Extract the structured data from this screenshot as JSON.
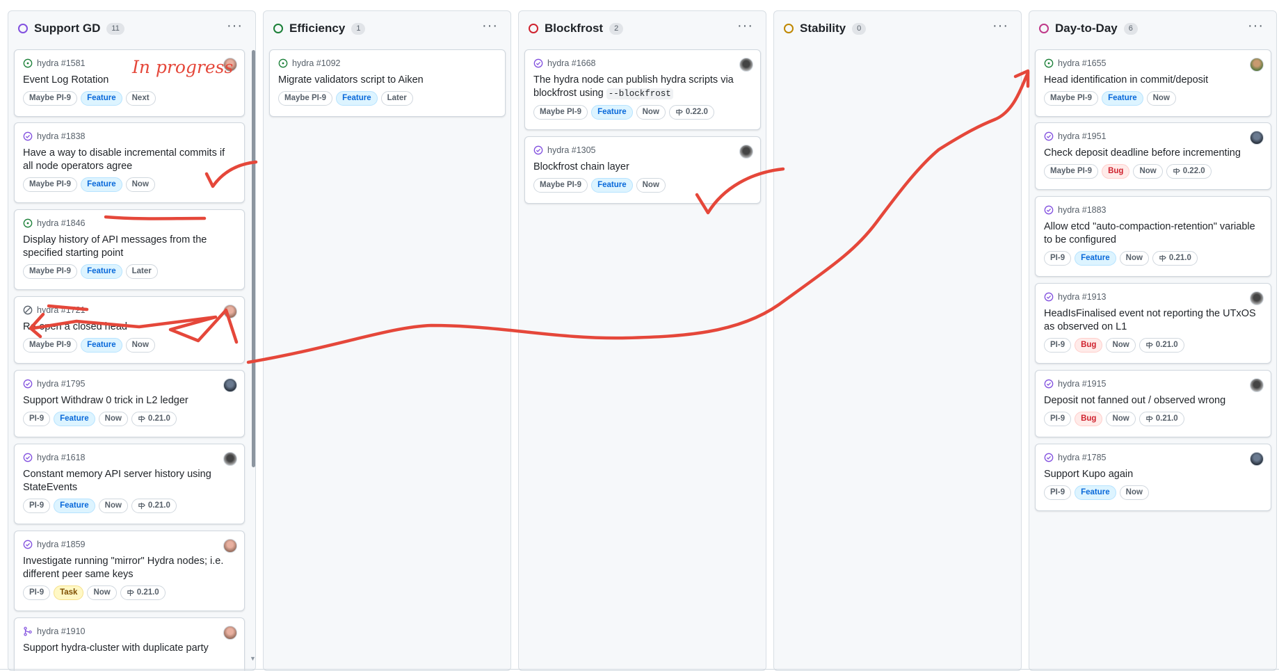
{
  "columns": [
    {
      "title": "Support GD",
      "count": "11",
      "ring": "#8250df"
    },
    {
      "title": "Efficiency",
      "count": "1",
      "ring": "#1a7f37"
    },
    {
      "title": "Blockfrost",
      "count": "2",
      "ring": "#cf222e"
    },
    {
      "title": "Stability",
      "count": "0",
      "ring": "#bf8700"
    },
    {
      "title": "Day-to-Day",
      "count": "6",
      "ring": "#bf3989"
    }
  ],
  "menu_glyph": "···",
  "support": [
    {
      "ref": "hydra #1581",
      "title": "Event Log Rotation",
      "labels": [
        "Maybe PI-9",
        "Feature",
        "Next"
      ]
    },
    {
      "ref": "hydra #1838",
      "title": "Have a way to disable incremental commits if all node operators agree",
      "labels": [
        "Maybe PI-9",
        "Feature",
        "Now"
      ]
    },
    {
      "ref": "hydra #1846",
      "title": "Display history of API messages from the specified starting point",
      "labels": [
        "Maybe PI-9",
        "Feature",
        "Later"
      ]
    },
    {
      "ref": "hydra #1721",
      "title": "Re-open a closed head",
      "labels": [
        "Maybe PI-9",
        "Feature",
        "Now"
      ]
    },
    {
      "ref": "hydra #1795",
      "title": "Support Withdraw 0 trick in L2 ledger",
      "labels": [
        "PI-9",
        "Feature",
        "Now",
        "0.21.0"
      ]
    },
    {
      "ref": "hydra #1618",
      "title": "Constant memory API server history using StateEvents",
      "labels": [
        "PI-9",
        "Feature",
        "Now",
        "0.21.0"
      ]
    },
    {
      "ref": "hydra #1859",
      "title": "Investigate running \"mirror\" Hydra nodes; i.e. different peer same keys",
      "labels": [
        "PI-9",
        "Task",
        "Now",
        "0.21.0"
      ]
    },
    {
      "ref": "hydra #1910",
      "title": "Support hydra-cluster with duplicate party",
      "labels": []
    }
  ],
  "efficiency": [
    {
      "ref": "hydra #1092",
      "title": "Migrate validators script to Aiken",
      "labels": [
        "Maybe PI-9",
        "Feature",
        "Later"
      ]
    }
  ],
  "blockfrost": [
    {
      "ref": "hydra #1668",
      "title": "The hydra node can publish hydra scripts via blockfrost using",
      "code": "--blockfrost",
      "labels": [
        "Maybe PI-9",
        "Feature",
        "Now",
        "0.22.0"
      ]
    },
    {
      "ref": "hydra #1305",
      "title": "Blockfrost chain layer",
      "labels": [
        "Maybe PI-9",
        "Feature",
        "Now"
      ]
    }
  ],
  "daytoday": [
    {
      "ref": "hydra #1655",
      "title": "Head identification in commit/deposit",
      "labels": [
        "Maybe PI-9",
        "Feature",
        "Now"
      ]
    },
    {
      "ref": "hydra #1951",
      "title": "Check deposit deadline before incrementing",
      "labels": [
        "Maybe PI-9",
        "Bug",
        "Now",
        "0.22.0"
      ]
    },
    {
      "ref": "hydra #1883",
      "title": "Allow etcd \"auto-compaction-retention\" variable to be configured",
      "labels": [
        "PI-9",
        "Feature",
        "Now",
        "0.21.0"
      ]
    },
    {
      "ref": "hydra #1913",
      "title": "HeadIsFinalised event not reporting the UTxOS as observed on L1",
      "labels": [
        "PI-9",
        "Bug",
        "Now",
        "0.21.0"
      ]
    },
    {
      "ref": "hydra #1915",
      "title": "Deposit not fanned out / observed wrong",
      "labels": [
        "PI-9",
        "Bug",
        "Now",
        "0.21.0"
      ]
    },
    {
      "ref": "hydra #1785",
      "title": "Support Kupo again",
      "labels": [
        "PI-9",
        "Feature",
        "Now"
      ]
    }
  ],
  "annotation": {
    "in_progress": "In progress",
    "color": "#e5473a"
  },
  "colors": {
    "open": "#1a7f37",
    "closed": "#8250df",
    "not_planned": "#57606a",
    "pr": "#8250df"
  }
}
